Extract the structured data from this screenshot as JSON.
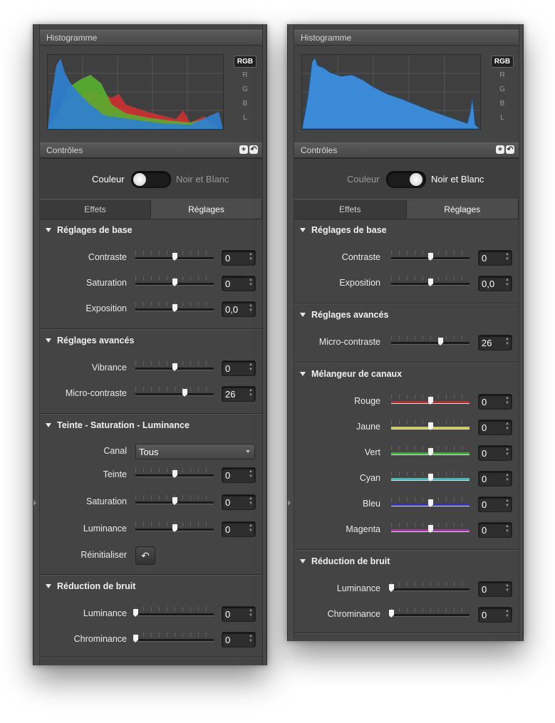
{
  "left": {
    "histogram_title": "Histogramme",
    "channels": [
      "RGB",
      "R",
      "G",
      "B",
      "L"
    ],
    "controls_title": "Contrôles",
    "add_icon": "plus-icon",
    "reset_icon": "undo-icon",
    "mode": {
      "left": "Couleur",
      "right": "Noir et Blanc",
      "active": "Couleur"
    },
    "tabs": [
      "Effets",
      "Réglages"
    ],
    "selected_tab": "Réglages",
    "groups": {
      "base": {
        "title": "Réglages de base",
        "rows": [
          {
            "label": "Contraste",
            "value": "0",
            "level": 0.5
          },
          {
            "label": "Saturation",
            "value": "0",
            "level": 0.5
          },
          {
            "label": "Exposition",
            "value": "0,0",
            "level": 0.5
          }
        ]
      },
      "advanced": {
        "title": "Réglages avancés",
        "rows": [
          {
            "label": "Vibrance",
            "value": "0",
            "level": 0.5
          },
          {
            "label": "Micro-contraste",
            "value": "26",
            "level": 0.63
          }
        ]
      },
      "tsl": {
        "title": "Teinte - Saturation - Luminance",
        "canal_label": "Canal",
        "canal_value": "Tous",
        "rows": [
          {
            "label": "Teinte",
            "value": "0",
            "level": 0.5
          },
          {
            "label": "Saturation",
            "value": "0",
            "level": 0.5
          },
          {
            "label": "Luminance",
            "value": "0",
            "level": 0.5
          }
        ],
        "reset_label": "Réinitialiser"
      },
      "noise": {
        "title": "Réduction de bruit",
        "rows": [
          {
            "label": "Luminance",
            "value": "0",
            "level": 0.0
          },
          {
            "label": "Chrominance",
            "value": "0",
            "level": 0.0
          }
        ]
      }
    }
  },
  "right": {
    "histogram_title": "Histogramme",
    "channels": [
      "RGB",
      "R",
      "G",
      "B",
      "L"
    ],
    "controls_title": "Contrôles",
    "mode": {
      "left": "Couleur",
      "right": "Noir et Blanc",
      "active": "Noir et Blanc"
    },
    "tabs": [
      "Effets",
      "Réglages"
    ],
    "selected_tab": "Réglages",
    "groups": {
      "base": {
        "title": "Réglages de base",
        "rows": [
          {
            "label": "Contraste",
            "value": "0",
            "level": 0.5
          },
          {
            "label": "Exposition",
            "value": "0,0",
            "level": 0.5
          }
        ]
      },
      "advanced": {
        "title": "Réglages avancés",
        "rows": [
          {
            "label": "Micro-contraste",
            "value": "26",
            "level": 0.63
          }
        ]
      },
      "mixer": {
        "title": "Mélangeur de canaux",
        "rows": [
          {
            "label": "Rouge",
            "value": "0",
            "level": 0.5,
            "color": "#d02020"
          },
          {
            "label": "Jaune",
            "value": "0",
            "level": 0.5,
            "color": "#d8d020"
          },
          {
            "label": "Vert",
            "value": "0",
            "level": 0.5,
            "color": "#20c020"
          },
          {
            "label": "Cyan",
            "value": "0",
            "level": 0.5,
            "color": "#20c8c8"
          },
          {
            "label": "Bleu",
            "value": "0",
            "level": 0.5,
            "color": "#3030e0"
          },
          {
            "label": "Magenta",
            "value": "0",
            "level": 0.5,
            "color": "#c020c0"
          }
        ]
      },
      "noise": {
        "title": "Réduction de bruit",
        "rows": [
          {
            "label": "Luminance",
            "value": "0",
            "level": 0.0
          },
          {
            "label": "Chrominance",
            "value": "0",
            "level": 0.0
          }
        ]
      }
    }
  }
}
